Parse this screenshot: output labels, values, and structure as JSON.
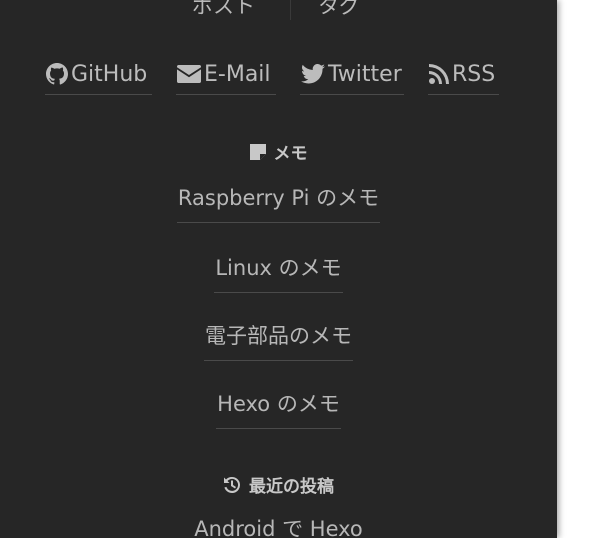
{
  "top_nav": {
    "posts": "ポスト",
    "tags": "タグ"
  },
  "social": {
    "github": "GitHub",
    "email": "E-Mail",
    "twitter": "Twitter",
    "rss": "RSS"
  },
  "memo_section": {
    "title": "メモ",
    "links": [
      "Raspberry Pi のメモ",
      "Linux のメモ",
      "電子部品のメモ",
      "Hexo のメモ"
    ]
  },
  "recent_section": {
    "title": "最近の投稿",
    "links": [
      "Android で Hexo"
    ]
  },
  "colors": {
    "background": "#262626",
    "text": "#b7b7b7",
    "underline": "#4a4a4a",
    "page": "#ffffff"
  }
}
